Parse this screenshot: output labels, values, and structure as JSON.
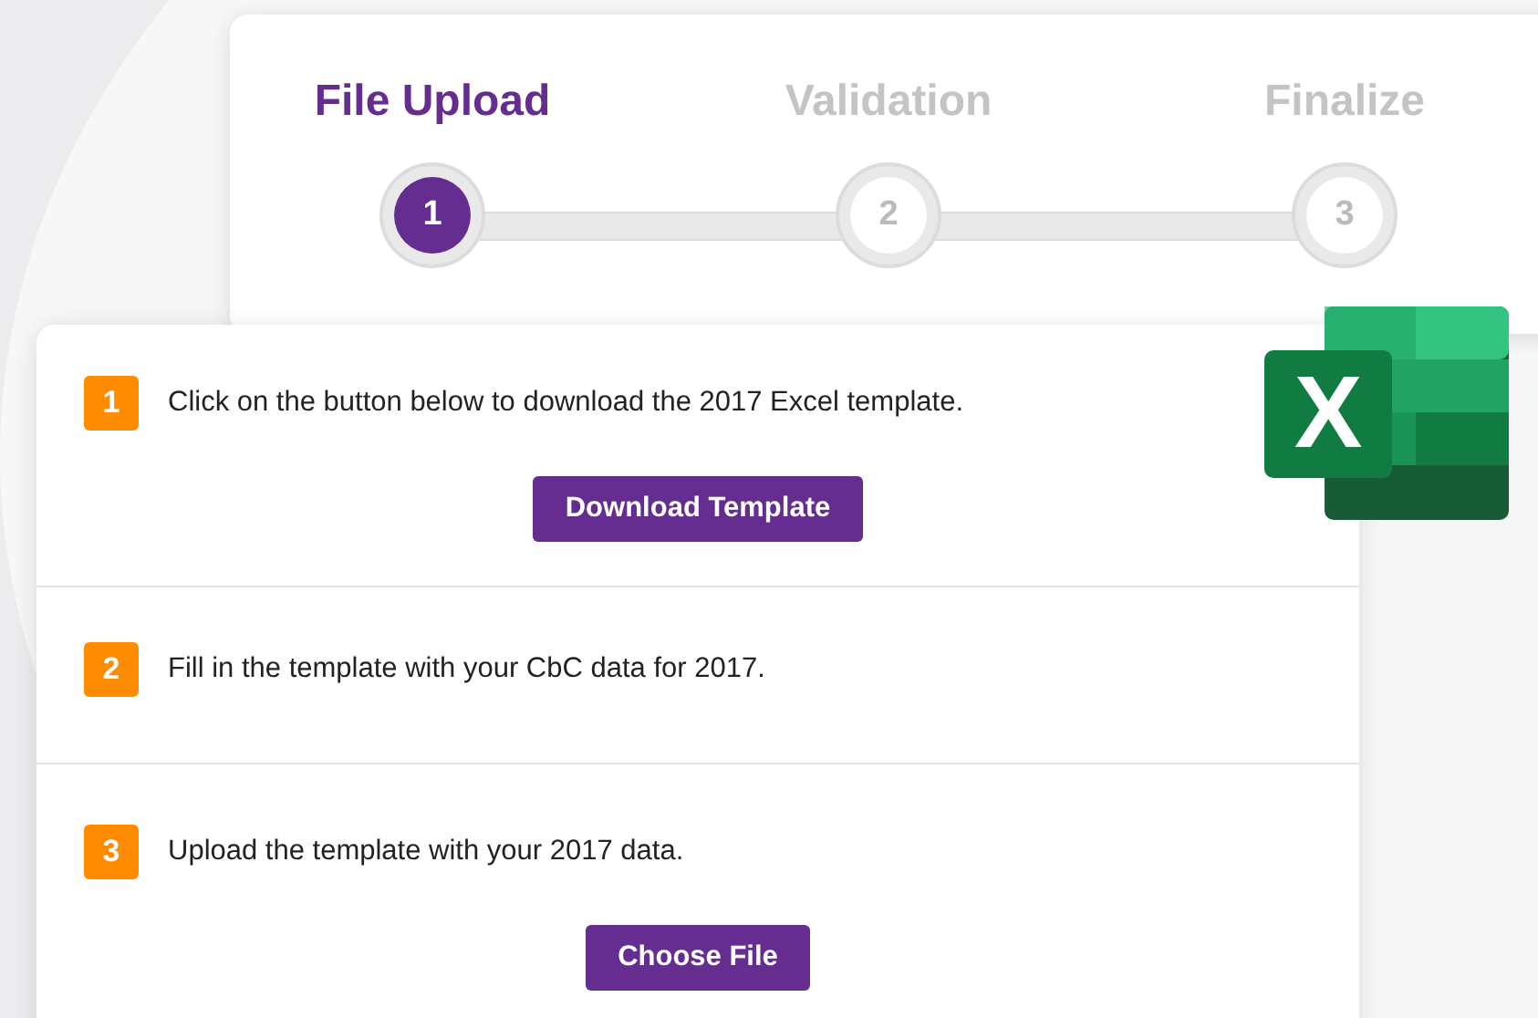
{
  "stepper": {
    "steps": [
      {
        "label": "File Upload",
        "number": "1",
        "selected": true
      },
      {
        "label": "Validation",
        "number": "2",
        "selected": false
      },
      {
        "label": "Finalize",
        "number": "3",
        "selected": false
      }
    ]
  },
  "logo": {
    "letter": "X"
  },
  "instructions": [
    {
      "number": "1",
      "text": "Click on the button below to download the 2017 Excel template.",
      "button": "Download Template"
    },
    {
      "number": "2",
      "text": "Fill in the template with your CbC data for 2017."
    },
    {
      "number": "3",
      "text": "Upload the template with your 2017 data.",
      "button": "Choose File"
    }
  ]
}
